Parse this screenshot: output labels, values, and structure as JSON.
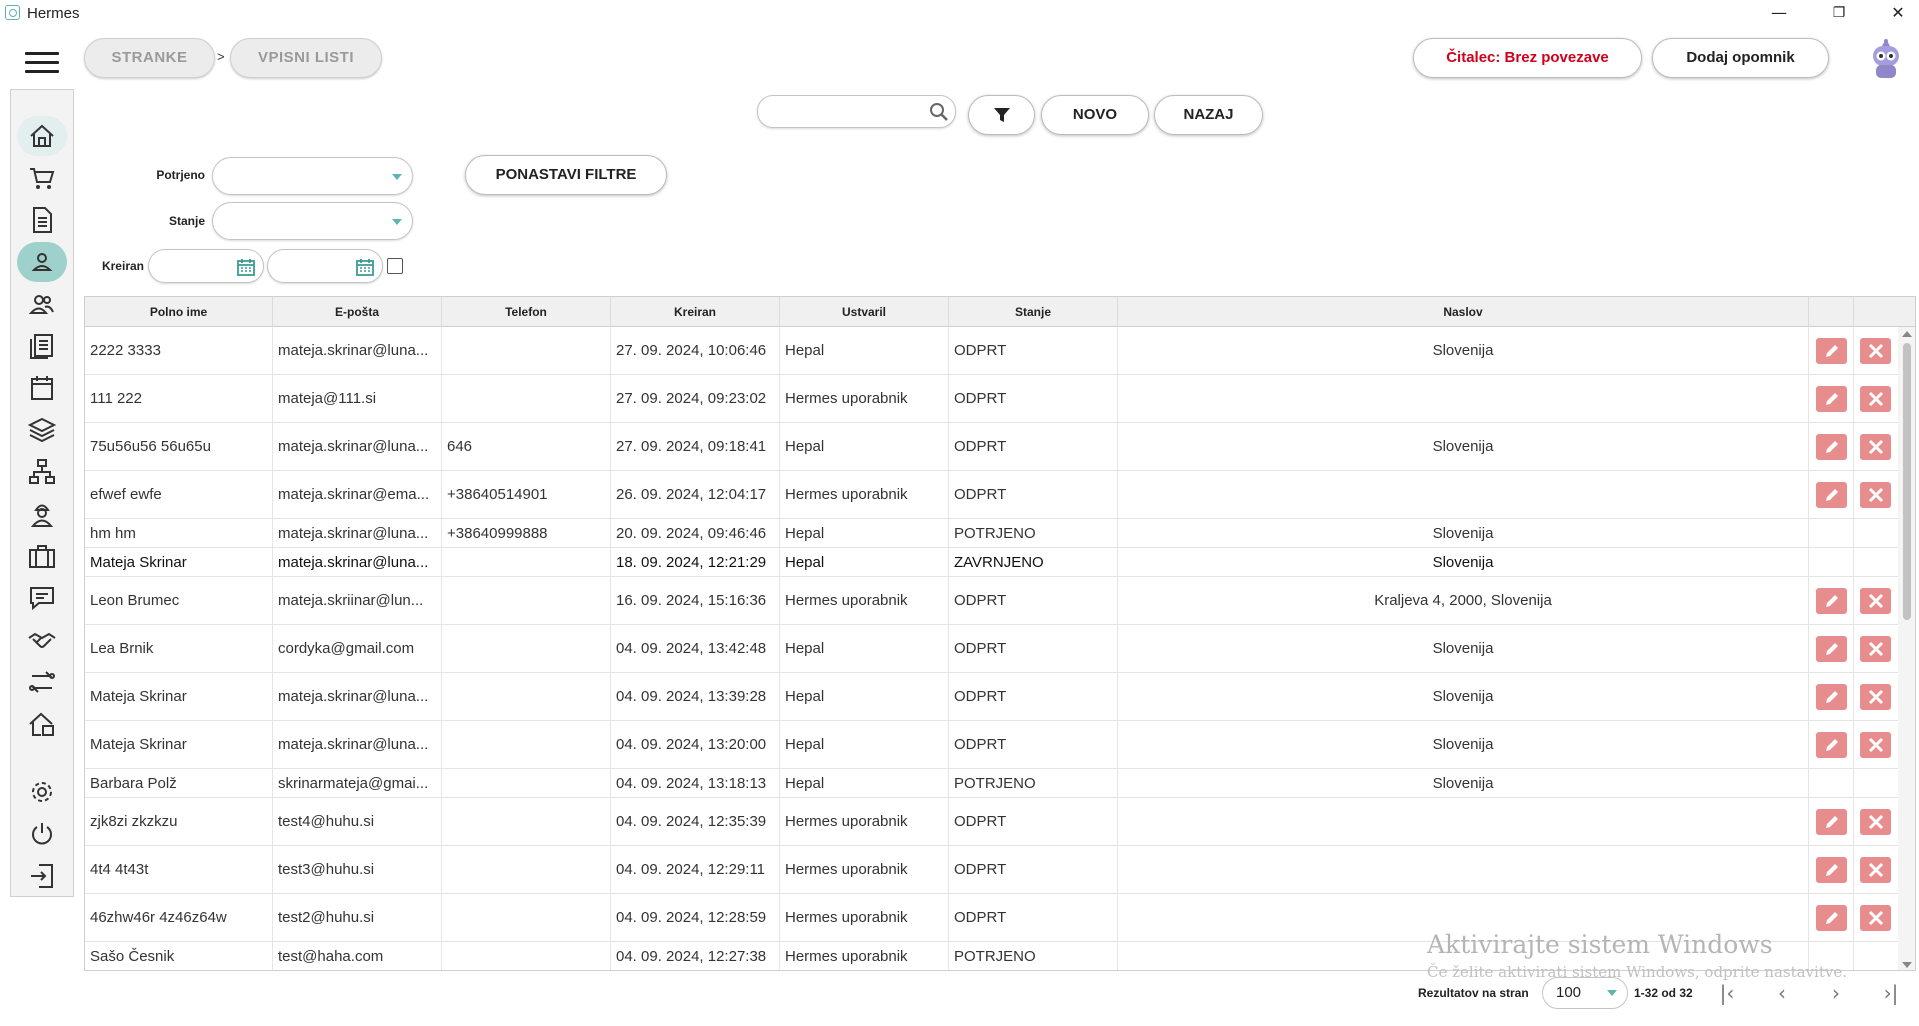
{
  "window": {
    "title": "Hermes",
    "minimize": "—",
    "restore": "❐",
    "close": "✕"
  },
  "breadcrumb": {
    "items": [
      "STRANKE",
      "VPISNI LISTI"
    ],
    "separator": ">"
  },
  "header": {
    "reader_status": "Čitalec: Brez povezave",
    "reader_status_color": "#d0021b",
    "reminder_button": "Dodaj opomnik"
  },
  "sidebar": {
    "icons": [
      "home-icon",
      "cart-icon",
      "document-icon",
      "person-icon",
      "group-icon",
      "list-icon",
      "calendar-icon",
      "layers-icon",
      "hierarchy-icon",
      "worker-icon",
      "briefcase-icon",
      "chat-icon",
      "handshake-icon",
      "transfer-icon",
      "house-icon",
      "gear-icon",
      "power-icon",
      "logout-icon"
    ],
    "active": "person-icon",
    "accent": "#9fd1cc"
  },
  "toolbar": {
    "search_value": "",
    "new_label": "NOVO",
    "back_label": "NAZAJ"
  },
  "filters": {
    "confirmed_label": "Potrjeno",
    "confirmed_value": "",
    "state_label": "Stanje",
    "state_value": "",
    "created_label": "Kreiran",
    "created_from": "",
    "created_to": "",
    "reset_label": "PONASTAVI FILTRE"
  },
  "table": {
    "columns": [
      "Polno ime",
      "E-pošta",
      "Telefon",
      "Kreiran",
      "Ustvaril",
      "Stanje",
      "Naslov",
      "",
      ""
    ],
    "rows": [
      {
        "name": "2222 3333",
        "email": "mateja.skrinar@luna...",
        "phone": "",
        "created": "27. 09. 2024, 10:06:46",
        "creator": "Hepal",
        "state": "ODPRT",
        "address": "Slovenija",
        "actions": true
      },
      {
        "name": "111 222",
        "email": "mateja@111.si",
        "phone": "",
        "created": "27. 09. 2024, 09:23:02",
        "creator": "Hermes uporabnik",
        "state": "ODPRT",
        "address": "",
        "actions": true
      },
      {
        "name": "75u56u56 56u65u",
        "email": "mateja.skrinar@luna...",
        "phone": "646",
        "created": "27. 09. 2024, 09:18:41",
        "creator": "Hepal",
        "state": "ODPRT",
        "address": "Slovenija",
        "actions": true
      },
      {
        "name": "efwef ewfe",
        "email": "mateja.skrinar@ema...",
        "phone": "+38640514901",
        "created": "26. 09. 2024, 12:04:17",
        "creator": "Hermes uporabnik",
        "state": "ODPRT",
        "address": "",
        "actions": true
      },
      {
        "name": "hm hm",
        "email": "mateja.skrinar@luna...",
        "phone": "+38640999888",
        "created": "20. 09. 2024, 09:46:46",
        "creator": "Hepal",
        "state": "POTRJENO",
        "address": "Slovenija",
        "actions": false
      },
      {
        "name": "Mateja Skrinar",
        "email": "mateja.skrinar@luna...",
        "phone": "",
        "created": "18. 09. 2024, 12:21:29",
        "creator": "Hepal",
        "state": "ZAVRNJENO",
        "address": "Slovenija",
        "actions": false
      },
      {
        "name": "Leon Brumec",
        "email": "mateja.skriinar@lun...",
        "phone": "",
        "created": "16. 09. 2024, 15:16:36",
        "creator": "Hermes uporabnik",
        "state": "ODPRT",
        "address": "Kraljeva 4, 2000, Slovenija",
        "actions": true
      },
      {
        "name": "Lea Brnik",
        "email": "cordyka@gmail.com",
        "phone": "",
        "created": "04. 09. 2024, 13:42:48",
        "creator": "Hepal",
        "state": "ODPRT",
        "address": "Slovenija",
        "actions": true
      },
      {
        "name": "Mateja Skrinar",
        "email": "mateja.skrinar@luna...",
        "phone": "",
        "created": "04. 09. 2024, 13:39:28",
        "creator": "Hepal",
        "state": "ODPRT",
        "address": "Slovenija",
        "actions": true
      },
      {
        "name": "Mateja Skrinar",
        "email": "mateja.skrinar@luna...",
        "phone": "",
        "created": "04. 09. 2024, 13:20:00",
        "creator": "Hepal",
        "state": "ODPRT",
        "address": "Slovenija",
        "actions": true
      },
      {
        "name": "Barbara Polž",
        "email": "skrinarmateja@gmai...",
        "phone": "",
        "created": "04. 09. 2024, 13:18:13",
        "creator": "Hepal",
        "state": "POTRJENO",
        "address": "Slovenija",
        "actions": false
      },
      {
        "name": "zjk8zi zkzkzu",
        "email": "test4@huhu.si",
        "phone": "",
        "created": "04. 09. 2024, 12:35:39",
        "creator": "Hermes uporabnik",
        "state": "ODPRT",
        "address": "",
        "actions": true
      },
      {
        "name": "4t4 4t43t",
        "email": "test3@huhu.si",
        "phone": "",
        "created": "04. 09. 2024, 12:29:11",
        "creator": "Hermes uporabnik",
        "state": "ODPRT",
        "address": "",
        "actions": true
      },
      {
        "name": "46zhw46r 4z46z64w",
        "email": "test2@huhu.si",
        "phone": "",
        "created": "04. 09. 2024, 12:28:59",
        "creator": "Hermes uporabnik",
        "state": "ODPRT",
        "address": "",
        "actions": true
      },
      {
        "name": "Sašo Česnik",
        "email": "test@haha.com",
        "phone": "",
        "created": "04. 09. 2024, 12:27:38",
        "creator": "Hermes uporabnik",
        "state": "POTRJENO",
        "address": "",
        "actions": false
      }
    ],
    "action_color": "#e88d8d"
  },
  "pagination": {
    "label": "Rezultatov na stran",
    "page_size": "100",
    "range": "1-32 od 32"
  },
  "watermark": {
    "line1": "Aktivirajte sistem Windows",
    "line2": "Če želite aktivirati sistem Windows, odprite nastavitve."
  }
}
